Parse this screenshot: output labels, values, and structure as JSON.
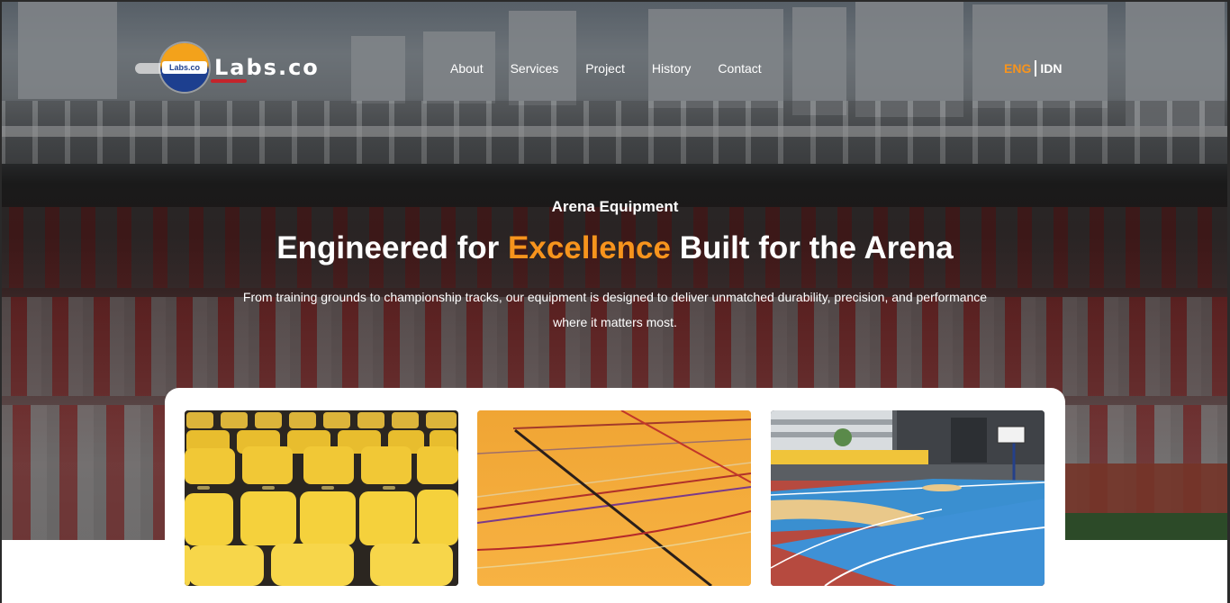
{
  "brand": {
    "logo_badge": "Labs.co",
    "name": "Labs.co"
  },
  "nav": {
    "items": [
      {
        "label": "About"
      },
      {
        "label": "Services"
      },
      {
        "label": "Project"
      },
      {
        "label": "History"
      },
      {
        "label": "Contact"
      }
    ]
  },
  "language": {
    "active": "ENG",
    "other": "IDN",
    "active_color": "#f7941d"
  },
  "hero": {
    "kicker": "Arena Equipment",
    "headline_before": "Engineered for ",
    "headline_accent": "Excellence",
    "headline_after": " Built for the Arena",
    "subtitle": "From training grounds to championship tracks, our equipment is designed to deliver unmatched durability, precision, and performance where it matters most.",
    "accent_color": "#f7941d"
  },
  "gallery": {
    "images": [
      {
        "subject": "yellow-stadium-seats"
      },
      {
        "subject": "orange-sports-floor"
      },
      {
        "subject": "outdoor-basketball-court"
      }
    ]
  }
}
